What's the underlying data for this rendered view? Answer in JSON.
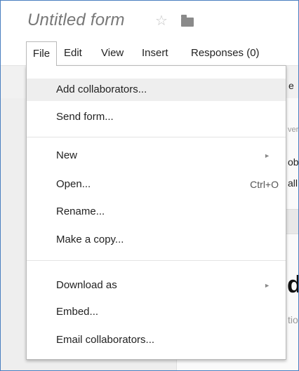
{
  "form_title": "Untitled form",
  "icons": {
    "star": "star-outline-icon",
    "folder": "folder-icon",
    "submenu": "submenu-arrow-icon"
  },
  "menubar": {
    "file": "File",
    "edit": "Edit",
    "view": "View",
    "insert": "Insert",
    "responses": "Responses (0)"
  },
  "file_menu": {
    "add_collaborators": "Add collaborators...",
    "send_form": "Send form...",
    "new": "New",
    "open": "Open...",
    "open_shortcut": "Ctrl+O",
    "rename": "Rename...",
    "make_copy": "Make a copy...",
    "download_as": "Download as",
    "embed": "Embed...",
    "email_collaborators": "Email collaborators..."
  },
  "background": {
    "toolbar_fragment": "e",
    "fragment_ver": "ver",
    "fragment_ob": "ob",
    "fragment_all": "all",
    "fragment_d": "d",
    "fragment_tio": "tio"
  },
  "colors": {
    "frame_border": "#4a7fc0",
    "hover": "#eeeeee",
    "title": "#777777"
  }
}
